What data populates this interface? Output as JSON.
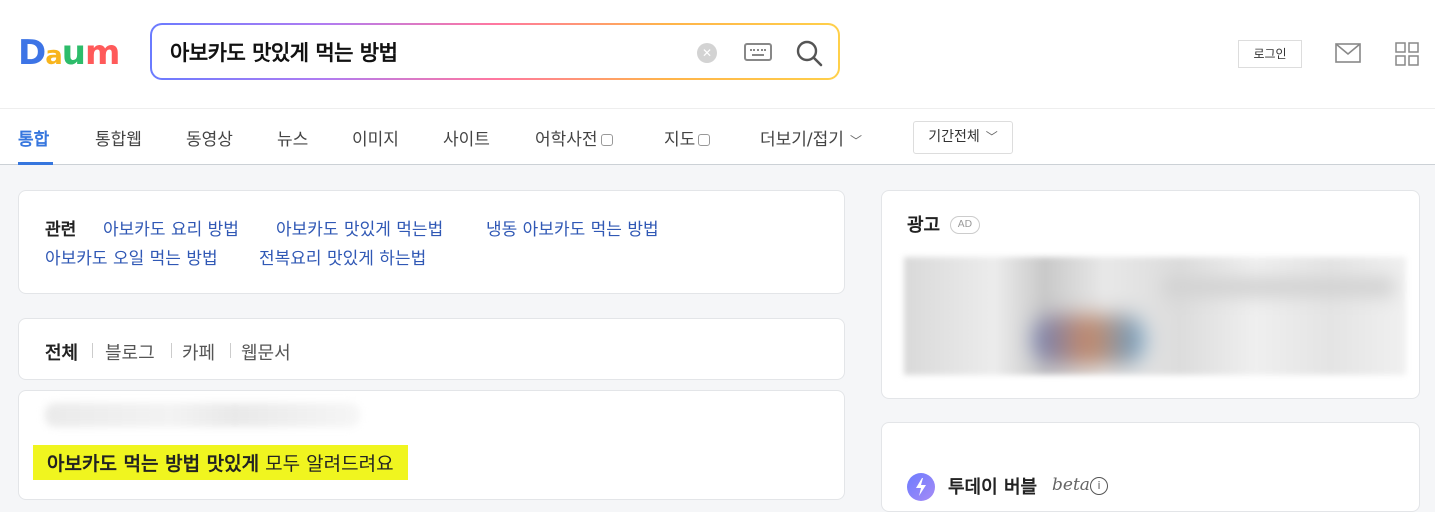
{
  "header": {
    "logo": "Daum",
    "search_value": "아보카도 맛있게 먹는 방법",
    "login_label": "로그인"
  },
  "tabs": {
    "items": [
      {
        "label": "통합"
      },
      {
        "label": "통합웹"
      },
      {
        "label": "동영상"
      },
      {
        "label": "뉴스"
      },
      {
        "label": "이미지"
      },
      {
        "label": "사이트"
      },
      {
        "label": "어학사전"
      },
      {
        "label": "지도"
      },
      {
        "label": "더보기/접기"
      }
    ],
    "period_label": "기간전체"
  },
  "related": {
    "title": "관련",
    "links": [
      "아보카도 요리 방법",
      "아보카도 맛있게 먹는법",
      "냉동 아보카도 먹는 방법",
      "아보카도 오일 먹는 방법",
      "전복요리 맛있게 하는법"
    ]
  },
  "filters": [
    "전체",
    "블로그",
    "카페",
    "웹문서"
  ],
  "result": {
    "title_bold": "아보카도 먹는 방법 맛있게",
    "title_rest": " 모두 알려드려요"
  },
  "ad": {
    "title": "광고",
    "badge": "AD"
  },
  "bubble": {
    "title": "투데이 버블",
    "beta": "beta",
    "info": "i"
  },
  "colors": {
    "accent": "#3676de",
    "link": "#3058b5",
    "highlight": "#f0f51f"
  }
}
